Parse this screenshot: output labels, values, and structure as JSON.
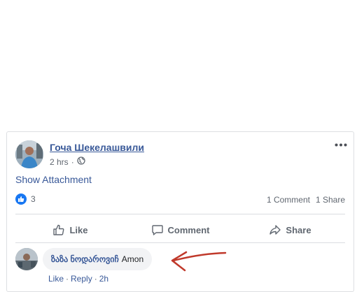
{
  "post": {
    "author": "Гоча Шекелашвили",
    "time": "2 hrs",
    "privacy_icon": "globe-icon",
    "attachment_link": "Show Attachment",
    "reaction_icon": "like-icon",
    "reaction_count": "3",
    "comment_count": "1 Comment",
    "share_count": "1 Share",
    "accent_color": "#385898",
    "like_blue": "#1877f2"
  },
  "actions": {
    "like": "Like",
    "comment": "Comment",
    "share": "Share"
  },
  "comment": {
    "author": "ზაზა ნოდაროვიჩ",
    "text": "Amon",
    "like_label": "Like",
    "reply_label": "Reply",
    "separator": "·",
    "time": "2h",
    "annotation_color": "#c0392b"
  }
}
